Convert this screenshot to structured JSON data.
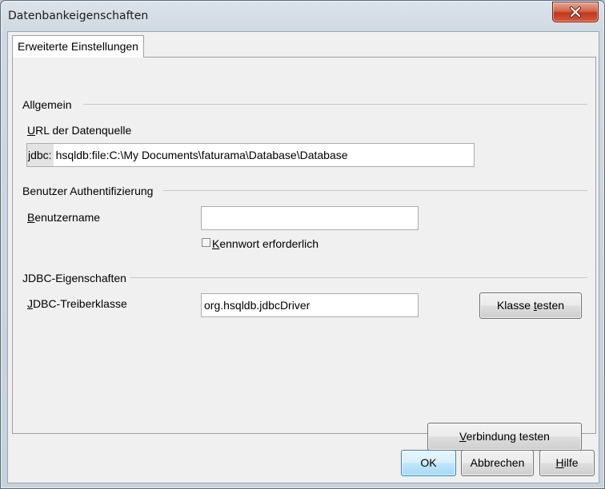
{
  "window": {
    "title": "Datenbankeigenschaften",
    "close_label": "Schließen"
  },
  "tabs": [
    {
      "label": "Erweiterte Einstellungen"
    }
  ],
  "general": {
    "heading": "Allgemein",
    "url_label_accel": "U",
    "url_label_rest": "RL der Datenquelle",
    "url_prefix": "jdbc:",
    "url_value": "hsqldb:file:C:\\My Documents\\faturama\\Database\\Database"
  },
  "auth": {
    "heading": "Benutzer Authentifizierung",
    "username_label_accel": "B",
    "username_label_rest": "enutzername",
    "username_value": "",
    "password_required_accel": "K",
    "password_required_rest": "ennwort erforderlich",
    "password_required_checked": false
  },
  "jdbc": {
    "heading": "JDBC-Eigenschaften",
    "driver_label_accel": "J",
    "driver_label_rest": "DBC-Treiberklasse",
    "driver_value": "org.hsqldb.jdbcDriver",
    "test_class_pre": "Klasse ",
    "test_class_accel": "t",
    "test_class_post": "esten"
  },
  "connection": {
    "test_accel": "V",
    "test_rest": "erbindung testen"
  },
  "footer": {
    "ok_label": "OK",
    "cancel_label": "Abbrechen",
    "help_accel": "H",
    "help_rest": "ilfe"
  }
}
